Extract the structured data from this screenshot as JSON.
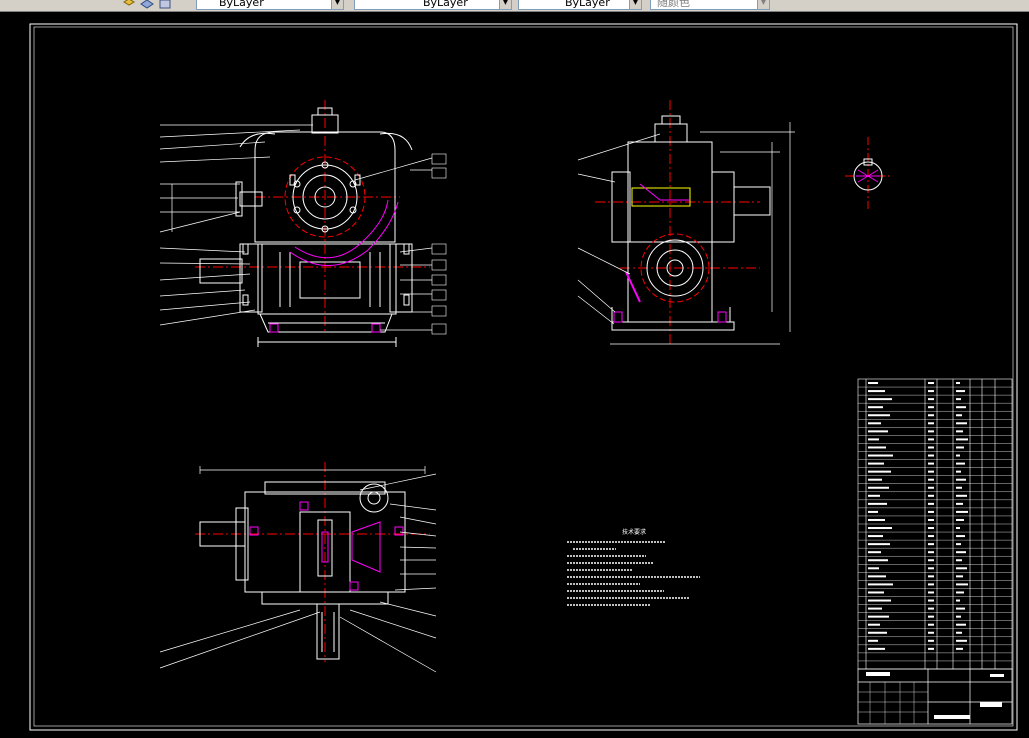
{
  "toolbar": {
    "layer_value": "ByLayer",
    "linetype_value": "ByLayer",
    "lineweight_value": "ByLayer",
    "plotstyle_value": "随颜色"
  },
  "drawing": {
    "views": [
      "front-view",
      "side-view",
      "top-view",
      "detail-section"
    ],
    "technical_requirements_title": "技术要求",
    "colors": {
      "outline": "#ffffff",
      "center": "#ff0000",
      "hidden": "#ffff00",
      "section": "#ff00ff",
      "dim": "#ffffff",
      "frame": "#ffffff"
    }
  }
}
